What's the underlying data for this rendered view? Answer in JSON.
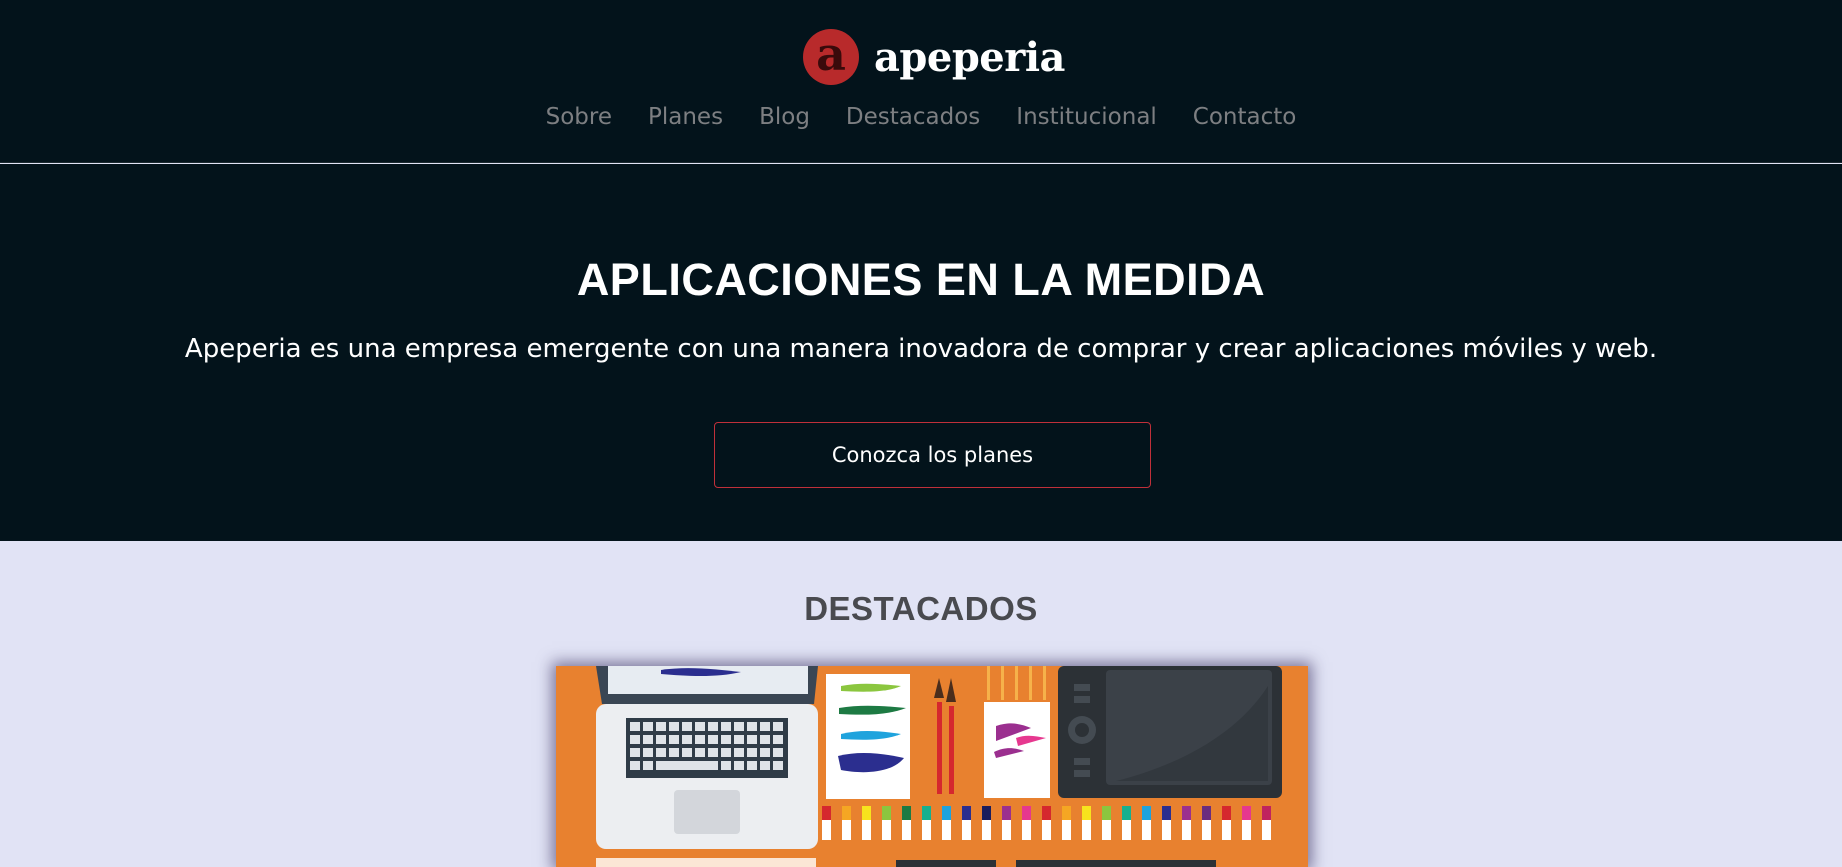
{
  "brand": {
    "logo_letter": "a",
    "name": "apeperia"
  },
  "nav": {
    "items": [
      {
        "label": "Sobre"
      },
      {
        "label": "Planes"
      },
      {
        "label": "Blog"
      },
      {
        "label": "Destacados"
      },
      {
        "label": "Institucional"
      },
      {
        "label": "Contacto"
      }
    ]
  },
  "hero": {
    "title": "APLICACIONES EN LA MEDIDA",
    "subtitle": "Apeperia es una empresa emergente con una manera inovadora de comprar y crear aplicaciones móviles y web.",
    "cta_label": "Conozca los planes"
  },
  "featured": {
    "title": "DESTACADOS"
  },
  "colors": {
    "header_bg": "#03131b",
    "accent_red": "#b82a2b",
    "section_bg": "#e1e3f5",
    "illustration_bg": "#e8812f"
  }
}
